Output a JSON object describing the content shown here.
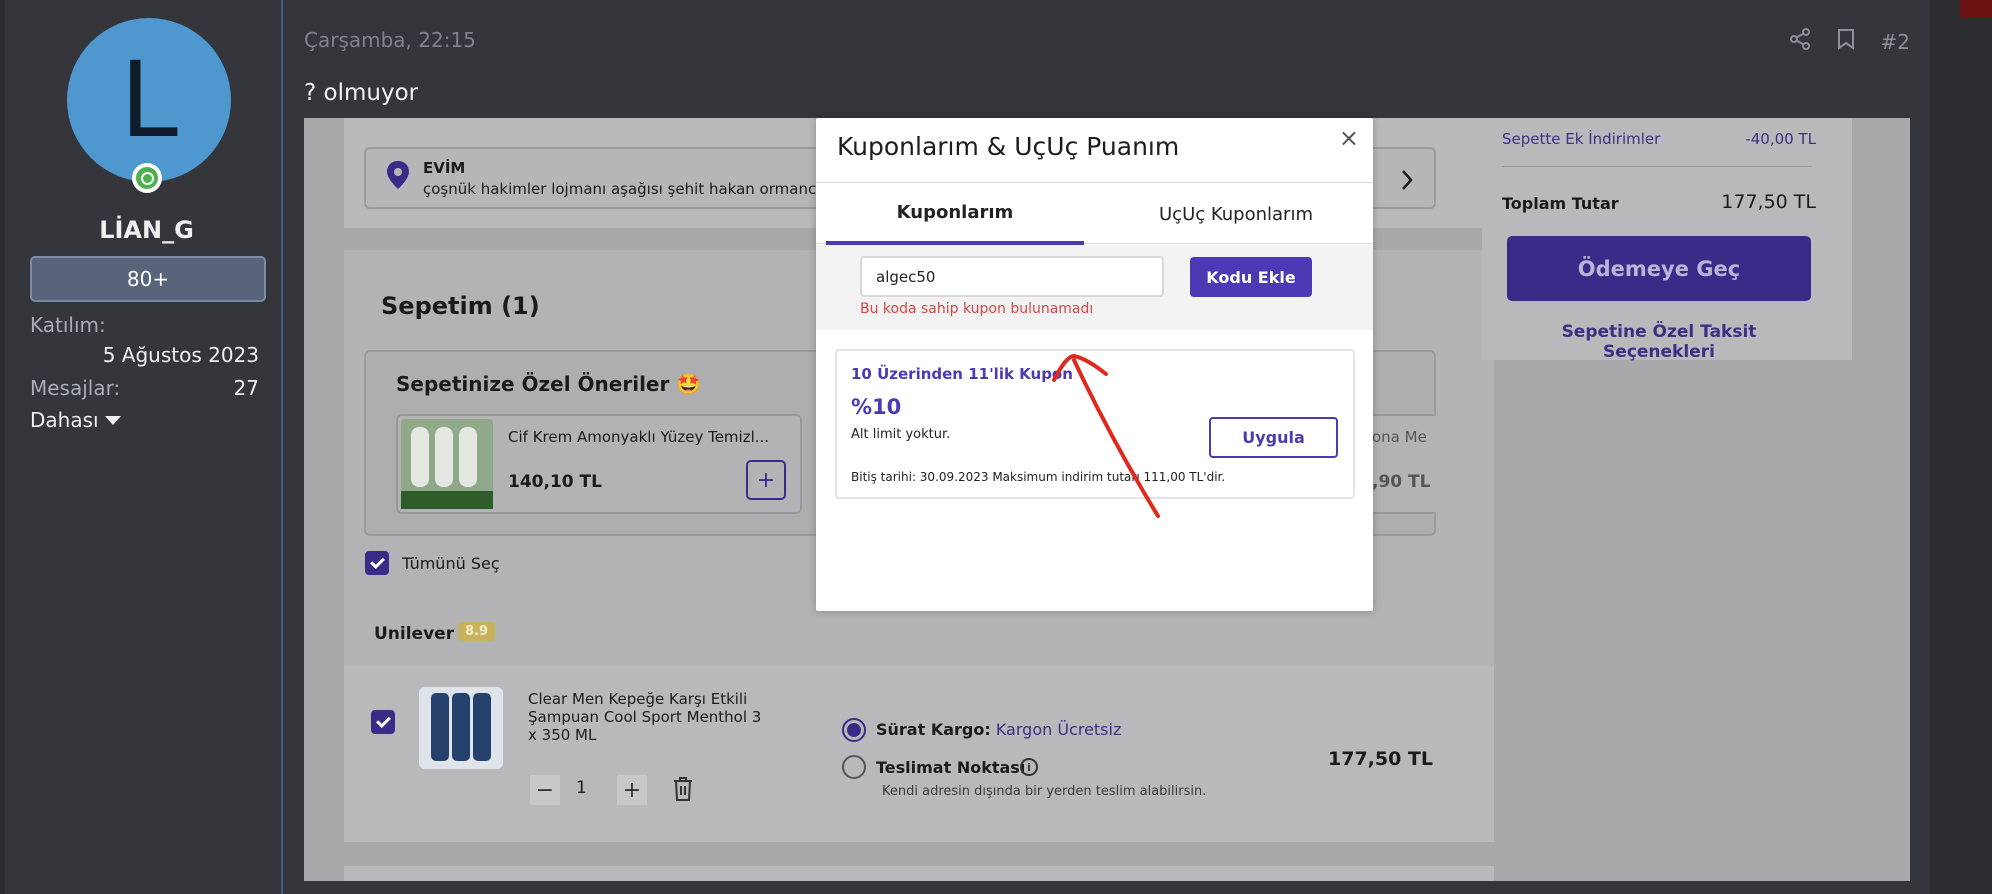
{
  "user": {
    "avatar_letter": "L",
    "name": "LİAN_G",
    "badge": "80+",
    "joined_label": "Katılım:",
    "joined_value": "5 Ağustos 2023",
    "messages_label": "Mesajlar:",
    "messages_value": "27",
    "more_label": "Dahası"
  },
  "post": {
    "date": "Çarşamba, 22:15",
    "number": "#2",
    "text": "? olmuyor",
    "icons": [
      "share-icon",
      "bookmark-icon"
    ]
  },
  "shot": {
    "address": {
      "label": "EVİM",
      "text": "çoşnük hakimler lojmanı aşağısı şehit hakan ormancı ..."
    },
    "cart_title": "Sepetim (1)",
    "suggestions_title": "Sepetinize Özel Öneriler 🤩",
    "suggestion": {
      "name": "Cif Krem Amonyaklı Yüzey Temizl...",
      "price": "140,10 TL",
      "add": "+"
    },
    "suggestion_partial": {
      "name": "ona Me",
      "price": ",90 TL"
    },
    "select_all": "Tümünü Seç",
    "seller": {
      "name": "Unilever",
      "rating": "8.9"
    },
    "product": {
      "name": "Clear Men Kepeğe Karşı Etkili Şampuan Cool Sport Menthol 3 x 350 ML",
      "qty": "1",
      "minus": "−",
      "plus": "+",
      "price": "177,50 TL"
    },
    "shipping": {
      "fast_label": "Sürat Kargo:",
      "fast_value": "Kargon Ücretsiz",
      "pickup_label": "Teslimat Noktası",
      "pickup_note": "Kendi adresin dışında bir yerden teslim alabilirsin."
    },
    "summary": {
      "discount_label": "Sepette Ek İndirimler",
      "discount_value": "-40,00 TL",
      "total_label": "Toplam Tutar",
      "total_value": "177,50 TL",
      "checkout": "Ödemeye Geç",
      "installments": "Sepetine Özel Taksit Seçenekleri"
    }
  },
  "modal": {
    "title": "Kuponlarım & UçUç Puanım",
    "close": "×",
    "tabs": [
      "Kuponlarım",
      "UçUç Kuponlarım"
    ],
    "code_value": "algec50",
    "code_button": "Kodu Ekle",
    "code_error": "Bu koda sahip kupon bulunamadı",
    "coupon": {
      "name": "10 Üzerinden 11'lik Kupon",
      "rate": "%10",
      "limit": "Alt limit yoktur.",
      "expiry": "Bitiş tarihi: 30.09.2023 Maksimum indirim tutarı 111,00 TL'dir.",
      "apply": "Uygula"
    }
  },
  "colors": {
    "accent": "#4d39b3",
    "error": "#d64545",
    "annotation": "#e0291e",
    "online": "#4caf50"
  }
}
